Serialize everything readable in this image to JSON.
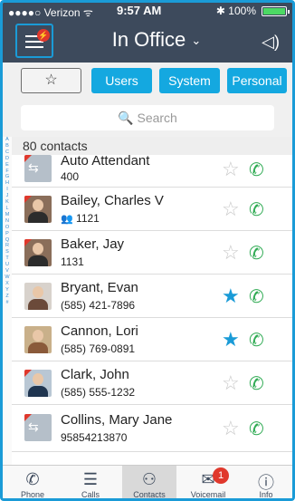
{
  "status": {
    "carrier": "●●●●○ Verizon ᯤ",
    "time": "9:57 AM",
    "battery": "✱ 100%"
  },
  "header": {
    "title": "In Office",
    "menu_badge": "⚡"
  },
  "filters": {
    "favorites": "☆",
    "users": "Users",
    "system": "System",
    "personal": "Personal"
  },
  "search": {
    "placeholder": "🔍 Search"
  },
  "index_letters": [
    "A",
    "B",
    "C",
    "D",
    "E",
    "F",
    "G",
    "H",
    "I",
    "J",
    "K",
    "L",
    "M",
    "N",
    "O",
    "P",
    "Q",
    "R",
    "S",
    "T",
    "U",
    "V",
    "W",
    "X",
    "Y",
    "Z",
    "#"
  ],
  "list": {
    "count": "80 contacts",
    "contacts": [
      {
        "name": "Auto Attendant",
        "sub": "400",
        "fav": false
      },
      {
        "name": "Bailey, Charles V",
        "sub": "1121",
        "group_icon": "👥",
        "fav": false
      },
      {
        "name": "Baker, Jay",
        "sub": "1131",
        "fav": false
      },
      {
        "name": "Bryant, Evan",
        "sub": "(585) 421-7896",
        "fav": true
      },
      {
        "name": "Cannon, Lori",
        "sub": "(585) 769-0891",
        "fav": true
      },
      {
        "name": "Clark, John",
        "sub": "(585) 555-1232",
        "fav": false
      },
      {
        "name": "Collins, Mary Jane",
        "sub": "95854213870",
        "fav": false
      }
    ]
  },
  "tabs": {
    "phone": "Phone",
    "calls": "Calls",
    "contacts": "Contacts",
    "voicemail": "Voicemail",
    "voicemail_badge": "1",
    "info": "Info"
  },
  "colors": {
    "header": "#3d4a5c",
    "accent": "#1a9bd7",
    "call": "#2eaa52",
    "alert": "#e0382c"
  }
}
